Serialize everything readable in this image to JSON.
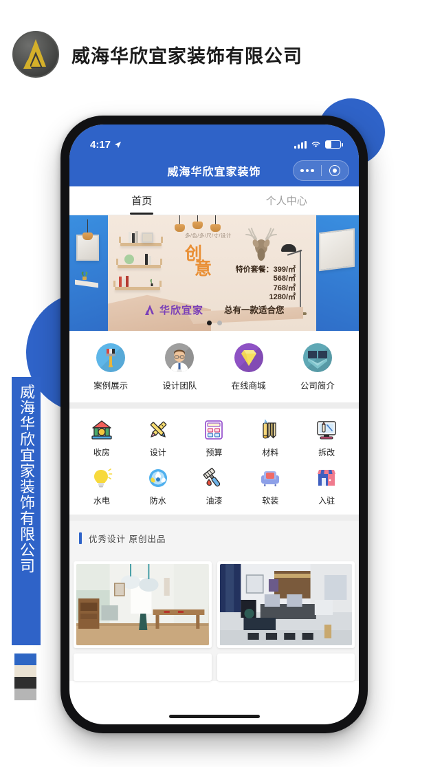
{
  "header": {
    "company_name": "威海华欣宜家装饰有限公司",
    "logo_icon": "circular-gold-monogram-logo"
  },
  "side_ribbon": {
    "text": "威海华欣宜家装饰有限公司"
  },
  "palette": {
    "swatches": [
      "#2E66C4",
      "#EAE2D3",
      "#2F2F2F",
      "#B5B5B5"
    ]
  },
  "phone": {
    "status_bar": {
      "time": "4:17",
      "location_icon": "location-arrow-icon",
      "signal_icon": "cellular-signal-icon",
      "wifi_icon": "wifi-icon",
      "battery_icon": "battery-icon"
    },
    "nav_bar": {
      "title": "威海华欣宜家装饰",
      "menu_icon": "more-dots-icon",
      "capsule_icon": "close-target-icon"
    },
    "tabs": [
      {
        "label": "首页",
        "active": true
      },
      {
        "label": "个人中心",
        "active": false
      }
    ],
    "banner": {
      "tagline": "多/色/多/尺/寸/设计",
      "headline_1": "创",
      "headline_2": "意",
      "package_label": "特价套餐：",
      "prices": [
        "399/㎡",
        "568/㎡",
        "768/㎡",
        "1280/㎡"
      ],
      "slogan": "总有一款适合您",
      "brand": "华欣宜家",
      "brand_mark_icon": "huaxin-logo-icon",
      "carousel_dots": 2,
      "active_dot": 1
    },
    "quick_nav": [
      {
        "label": "案例展示",
        "icon": "paint-brush-icon",
        "color": "#5EB6E8"
      },
      {
        "label": "设计团队",
        "icon": "designer-person-icon",
        "color": "#9E9E9E"
      },
      {
        "label": "在线商城",
        "icon": "diamond-icon",
        "color": "#8E52C4"
      },
      {
        "label": "公司简介",
        "icon": "open-book-icon",
        "color": "#5FA8B5"
      }
    ],
    "services_row1": [
      {
        "label": "收房",
        "icon": "house-handover-icon"
      },
      {
        "label": "设计",
        "icon": "pencil-ruler-icon"
      },
      {
        "label": "预算",
        "icon": "calculator-icon"
      },
      {
        "label": "材料",
        "icon": "material-rolls-icon"
      },
      {
        "label": "拆改",
        "icon": "demolition-screen-icon"
      }
    ],
    "services_row2": [
      {
        "label": "水电",
        "icon": "lightbulb-icon"
      },
      {
        "label": "防水",
        "icon": "waterproof-drops-icon"
      },
      {
        "label": "油漆",
        "icon": "paint-roller-icon"
      },
      {
        "label": "软装",
        "icon": "sofa-icon"
      },
      {
        "label": "入驻",
        "icon": "shop-icon"
      }
    ],
    "design_section": {
      "title": "优秀设计 原创出品",
      "cards": [
        {
          "alt": "nordic-dining-living-room-photo"
        },
        {
          "alt": "modern-chinese-living-room-photo"
        }
      ]
    },
    "home_indicator": "home-indicator-bar"
  },
  "colors": {
    "primary_blue": "#2F63C8",
    "banner_orange": "#E98F35",
    "brand_purple": "#7A3FB8"
  }
}
